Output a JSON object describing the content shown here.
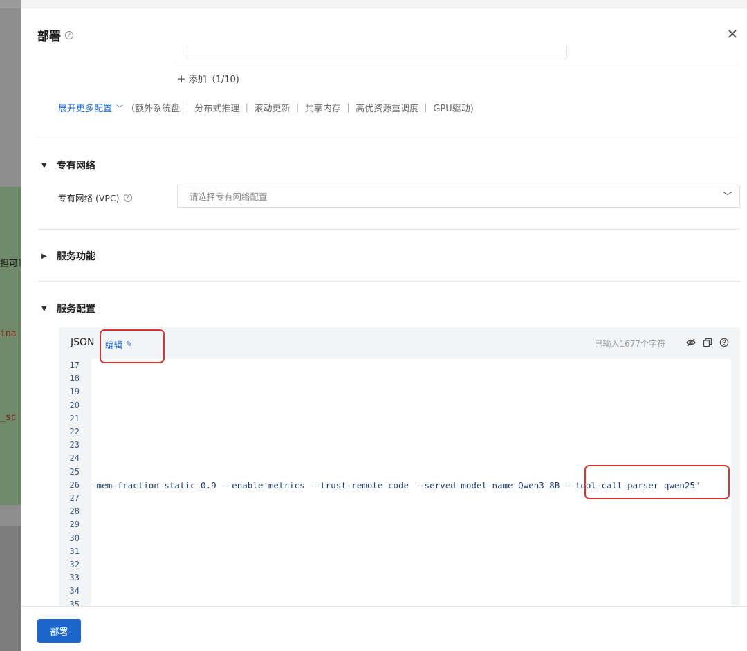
{
  "background": {
    "fragments": [
      "担可能",
      "ina",
      "_sc"
    ]
  },
  "drawer": {
    "title": "部署",
    "help_icon": "question-circle-icon",
    "close_icon": "close-icon"
  },
  "add_row": {
    "label": "添加（1/10)"
  },
  "more_config": {
    "link": "展开更多配置",
    "items": "（额外系统盘 ｜ 分布式推理 ｜ 滚动更新 ｜ 共享内存 ｜ 高优资源重调度 ｜ GPU驱动)"
  },
  "sections": {
    "vpc": {
      "title": "专有网络",
      "field_label": "专有网络 (VPC)",
      "placeholder": "请选择专有网络配置"
    },
    "service_features": {
      "title": "服务功能"
    },
    "service_config": {
      "title": "服务配置"
    }
  },
  "json_editor": {
    "title": "JSON",
    "edit_label": "编辑",
    "char_count": "已输入1677个字符",
    "tools": [
      "eye-off-icon",
      "copy-icon",
      "question-circle-icon"
    ],
    "lines": [
      {
        "num": "17",
        "text": ""
      },
      {
        "num": "18",
        "text": ""
      },
      {
        "num": "19",
        "text": ""
      },
      {
        "num": "20",
        "text": ""
      },
      {
        "num": "21",
        "text": ""
      },
      {
        "num": "22",
        "text": ""
      },
      {
        "num": "23",
        "text": ""
      },
      {
        "num": "24",
        "text": ""
      },
      {
        "num": "25",
        "text": ""
      },
      {
        "num": "26",
        "text": "-mem-fraction-static 0.9 --enable-metrics --trust-remote-code --served-model-name Qwen3-8B --tool-call-parser qwen25\""
      },
      {
        "num": "27",
        "text": ""
      },
      {
        "num": "28",
        "text": ""
      },
      {
        "num": "29",
        "text": ""
      },
      {
        "num": "30",
        "text": ""
      },
      {
        "num": "31",
        "text": ""
      },
      {
        "num": "32",
        "text": ""
      },
      {
        "num": "33",
        "text": ""
      },
      {
        "num": "34",
        "text": ""
      },
      {
        "num": "35",
        "text": ""
      }
    ]
  },
  "footer": {
    "deploy_label": "部署"
  },
  "colors": {
    "accent": "#1a66cc",
    "annotation": "#e03131"
  }
}
